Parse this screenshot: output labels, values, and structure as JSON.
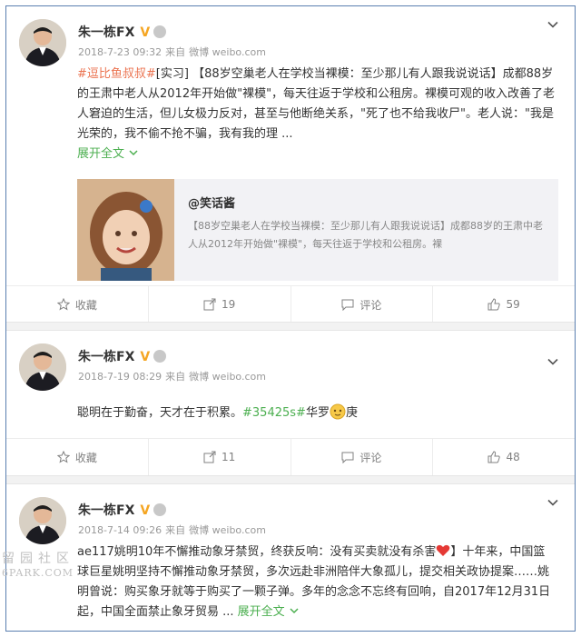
{
  "posts": [
    {
      "author": "朱一栋FX",
      "verified_badge": "V",
      "meta": {
        "date": "2018-7-23 09:32",
        "source_prefix": "来自",
        "source": "微博 weibo.com"
      },
      "text": {
        "link1": "#逗比鱼叔叔#",
        "plain1": "[实习] 【88岁空巢老人在学校当裸模：至少那儿有人跟我说说话】成都88岁的王肃中老人从2012年开始做\"裸模\"，每天往返于学校和公租房。裸模可观的收入改善了老人窘迫的生活，但儿女极力反对，甚至与他断绝关系，\"死了也不给我收尸\"。老人说：\"我是光荣的，我不偷不抢不骗，我有我的理 ...",
        "expand": "展开全文"
      },
      "card": {
        "author": "@笑话酱",
        "text": "【88岁空巢老人在学校当裸模：至少那儿有人跟我说说话】成都88岁的王肃中老人从2012年开始做\"裸模\"，每天往返于学校和公租房。裸"
      },
      "actions": {
        "favorite": "收藏",
        "repost": "19",
        "comment": "评论",
        "like": "59"
      }
    },
    {
      "author": "朱一栋FX",
      "verified_badge": "V",
      "meta": {
        "date": "2018-7-19 08:29",
        "source_prefix": "来自",
        "source": "微博 weibo.com"
      },
      "text": {
        "plain1": "聪明在于勤奋，天才在于积累。",
        "tag": "#35425s#",
        "plain2": "华罗",
        "plain3": "庚"
      },
      "actions": {
        "favorite": "收藏",
        "repost": "11",
        "comment": "评论",
        "like": "48"
      }
    },
    {
      "author": "朱一栋FX",
      "verified_badge": "V",
      "meta": {
        "date": "2018-7-14 09:26",
        "source_prefix": "来自",
        "source": "微博 weibo.com"
      },
      "text": {
        "plain1": "ae117姚明10年不懈推动象牙禁贸，终获反响：没有买卖就没有杀害",
        "plain2": "】十年来，中国篮球巨星姚明坚持不懈推动象牙禁贸，多次远赴非洲陪伴大象孤儿，提交相关政协提案……姚明曾说：购买象牙就等于购买了一颗子弹。多年的念念不忘终有回响，自2017年12月31日起，中国全面禁止象牙贸易 ...",
        "expand": "展开全文"
      }
    }
  ],
  "watermark": {
    "line1": "留园社区",
    "line2": "6PARK.COM"
  },
  "colors": {
    "link": "#eb7350",
    "tag": "#4caf50",
    "badge": "#f5a623",
    "frame": "#5b7fb0"
  }
}
